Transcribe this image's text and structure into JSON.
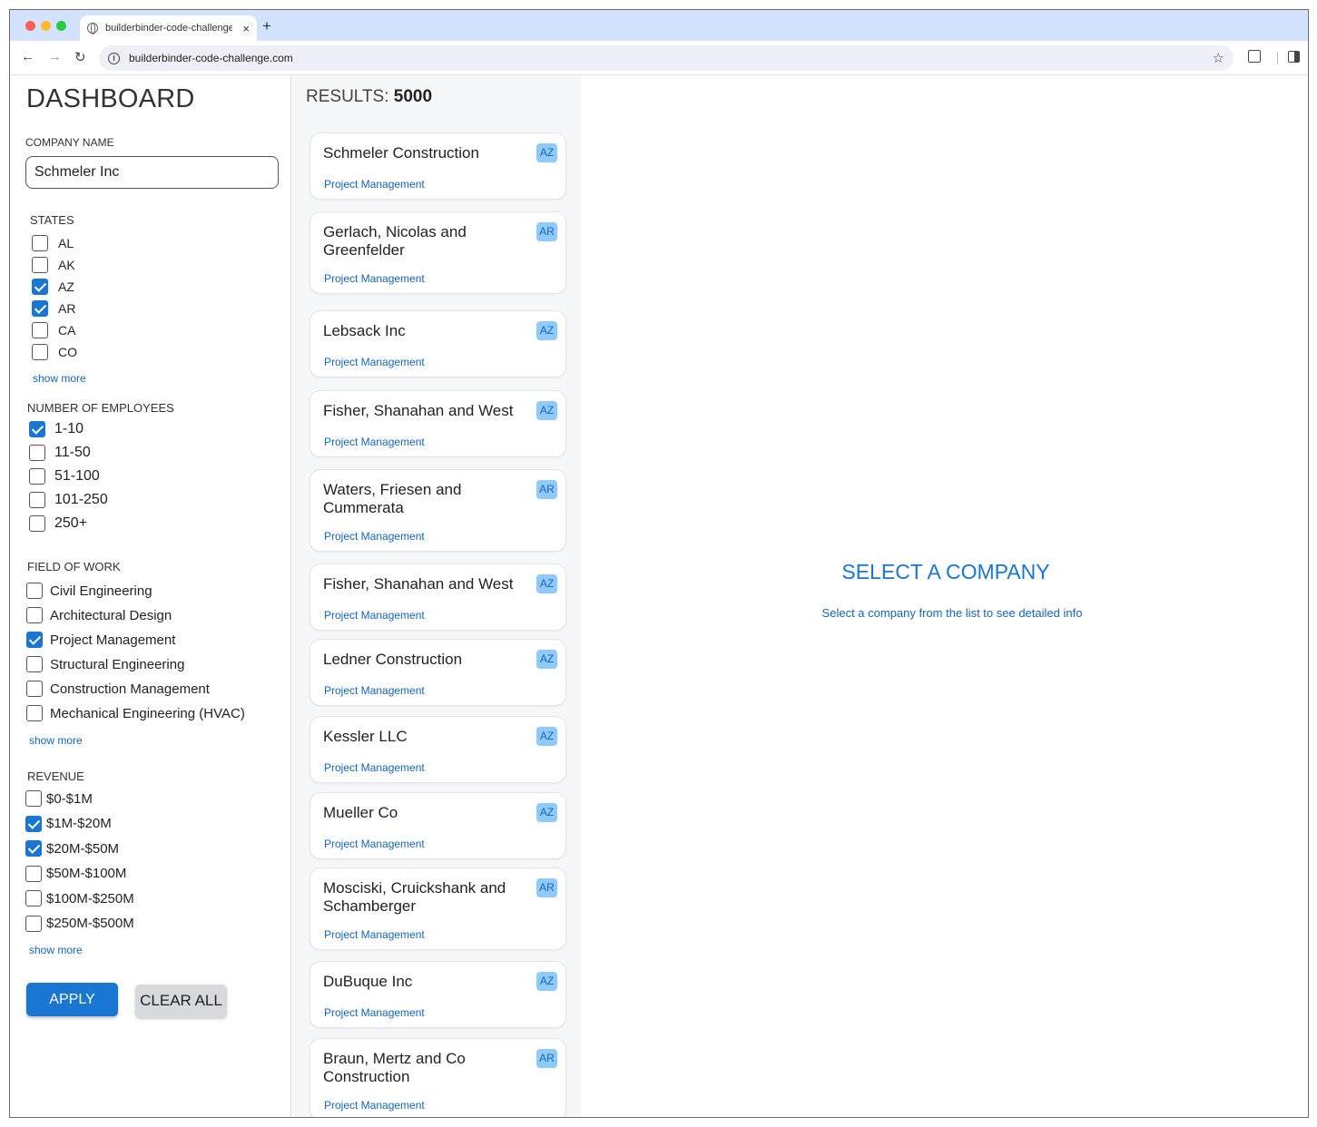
{
  "browser": {
    "tab_title": "builderbinder-code-challenge.com",
    "new_tab_label": "+",
    "close_label": "×",
    "url": "builderbinder-code-challenge.com"
  },
  "sidebar": {
    "title": "DASHBOARD",
    "company_label": "COMPANY NAME",
    "company_value": "Schmeler Inc",
    "states_label": "STATES",
    "states": [
      {
        "label": "AL",
        "checked": false
      },
      {
        "label": "AK",
        "checked": false
      },
      {
        "label": "AZ",
        "checked": true
      },
      {
        "label": "AR",
        "checked": true
      },
      {
        "label": "CA",
        "checked": false
      },
      {
        "label": "CO",
        "checked": false
      }
    ],
    "employees_label": "NUMBER OF EMPLOYEES",
    "employees": [
      {
        "label": "1-10",
        "checked": true
      },
      {
        "label": "11-50",
        "checked": false
      },
      {
        "label": "51-100",
        "checked": false
      },
      {
        "label": "101-250",
        "checked": false
      },
      {
        "label": "250+",
        "checked": false
      }
    ],
    "field_label": "FIELD OF WORK",
    "fields": [
      {
        "label": "Civil Engineering",
        "checked": false
      },
      {
        "label": "Architectural Design",
        "checked": false
      },
      {
        "label": "Project Management",
        "checked": true
      },
      {
        "label": "Structural Engineering",
        "checked": false
      },
      {
        "label": "Construction Management",
        "checked": false
      },
      {
        "label": "Mechanical Engineering (HVAC)",
        "checked": false
      }
    ],
    "revenue_label": "REVENUE",
    "revenue": [
      {
        "label": "$0-$1M",
        "checked": false
      },
      {
        "label": "$1M-$20M",
        "checked": true
      },
      {
        "label": "$20M-$50M",
        "checked": true
      },
      {
        "label": "$50M-$100M",
        "checked": false
      },
      {
        "label": "$100M-$250M",
        "checked": false
      },
      {
        "label": "$250M-$500M",
        "checked": false
      }
    ],
    "show_more": "show more",
    "apply_label": "APPLY",
    "clear_label": "CLEAR ALL"
  },
  "results": {
    "label": "RESULTS:",
    "count": "5000",
    "cards": [
      {
        "name": "Schmeler Construction",
        "field": "Project Management",
        "state": "AZ"
      },
      {
        "name": "Gerlach, Nicolas and Greenfelder",
        "field": "Project Management",
        "state": "AR"
      },
      {
        "name": "Lebsack Inc",
        "field": "Project Management",
        "state": "AZ"
      },
      {
        "name": "Fisher, Shanahan and West",
        "field": "Project Management",
        "state": "AZ"
      },
      {
        "name": "Waters, Friesen and Cummerata",
        "field": "Project Management",
        "state": "AR"
      },
      {
        "name": "Fisher, Shanahan and West",
        "field": "Project Management",
        "state": "AZ"
      },
      {
        "name": "Ledner Construction",
        "field": "Project Management",
        "state": "AZ"
      },
      {
        "name": "Kessler LLC",
        "field": "Project Management",
        "state": "AZ"
      },
      {
        "name": "Mueller Co",
        "field": "Project Management",
        "state": "AZ"
      },
      {
        "name": "Mosciski, Cruickshank and Schamberger",
        "field": "Project Management",
        "state": "AR"
      },
      {
        "name": "DuBuque Inc",
        "field": "Project Management",
        "state": "AZ"
      },
      {
        "name": "Braun, Mertz and Co Construction",
        "field": "Project Management",
        "state": "AR"
      }
    ]
  },
  "detail": {
    "title": "SELECT A COMPANY",
    "subtitle": "Select a company from the list to see detailed info"
  }
}
